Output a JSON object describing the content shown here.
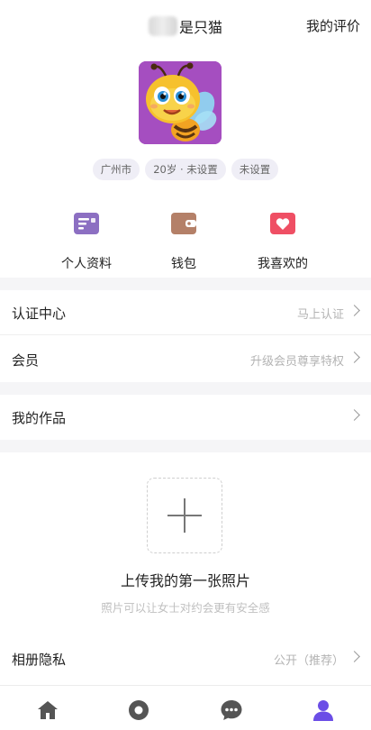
{
  "header": {
    "title": "是只猫",
    "right_link": "我的评价"
  },
  "profile": {
    "tags": [
      "广州市",
      "20岁 · 未设置",
      "未设置"
    ]
  },
  "quick_actions": [
    {
      "label": "个人资料",
      "icon": "profile-card-icon",
      "color": "#8c6fc2"
    },
    {
      "label": "钱包",
      "icon": "wallet-icon",
      "color": "#b48068"
    },
    {
      "label": "我喜欢的",
      "icon": "heart-icon",
      "color": "#ef4f64"
    }
  ],
  "rows": {
    "certification": {
      "label": "认证中心",
      "value": "马上认证"
    },
    "membership": {
      "label": "会员",
      "value": "升级会员尊享特权"
    },
    "my_works": {
      "label": "我的作品",
      "value": ""
    },
    "album_privacy": {
      "label": "相册隐私",
      "value": "公开（推荐）"
    }
  },
  "upload": {
    "title": "上传我的第一张照片",
    "subtitle": "照片可以让女士对约会更有安全感"
  },
  "tabbar": {
    "items": [
      "home-icon",
      "discover-icon",
      "messages-icon",
      "profile-icon"
    ],
    "active_color": "#6b4ee6",
    "inactive_color": "#555555"
  }
}
